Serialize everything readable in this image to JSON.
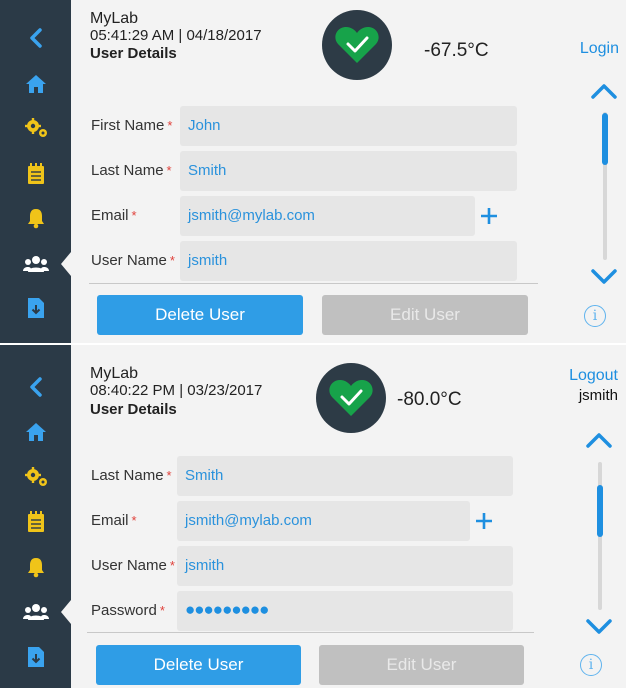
{
  "colors": {
    "sidebar_bg": "#2b3a47",
    "main_bg": "#f3f3f3",
    "accent": "#1e8fe0",
    "heart": "#17a34a",
    "required": "#e0403a",
    "disabled_button": "#c0c0c0"
  },
  "screens": [
    {
      "header": {
        "app_name": "MyLab",
        "datetime": "05:41:29 AM | 04/18/2017",
        "title": "User Details",
        "temperature": "-67.5°C",
        "auth_link": "Login",
        "username": ""
      },
      "sidebar": {
        "items": [
          {
            "name": "back",
            "icon": "chevron-left-icon"
          },
          {
            "name": "home",
            "icon": "home-icon"
          },
          {
            "name": "settings",
            "icon": "gears-icon"
          },
          {
            "name": "notepad",
            "icon": "notepad-icon"
          },
          {
            "name": "alarms",
            "icon": "bell-icon"
          },
          {
            "name": "users",
            "icon": "users-icon",
            "active": true
          },
          {
            "name": "export",
            "icon": "file-download-icon"
          }
        ]
      },
      "form": {
        "fields": [
          {
            "label": "First Name",
            "required_mark": "*",
            "value": "John"
          },
          {
            "label": "Last Name",
            "required_mark": "*",
            "value": "Smith"
          },
          {
            "label": "Email",
            "required_mark": "*",
            "value": "jsmith@mylab.com"
          },
          {
            "label": "User Name",
            "required_mark": "*",
            "value": "jsmith"
          }
        ]
      },
      "scroll": {
        "position": 0.0
      },
      "buttons": {
        "delete": "Delete User",
        "edit": "Edit User"
      },
      "info_glyph": "i"
    },
    {
      "header": {
        "app_name": "MyLab",
        "datetime": "08:40:22 PM | 03/23/2017",
        "title": "User Details",
        "temperature": "-80.0°C",
        "auth_link": "Logout",
        "username": "jsmith"
      },
      "sidebar": {
        "items": [
          {
            "name": "back",
            "icon": "chevron-left-icon"
          },
          {
            "name": "home",
            "icon": "home-icon"
          },
          {
            "name": "settings",
            "icon": "gears-icon"
          },
          {
            "name": "notepad",
            "icon": "notepad-icon"
          },
          {
            "name": "alarms",
            "icon": "bell-icon"
          },
          {
            "name": "users",
            "icon": "users-icon",
            "active": true
          },
          {
            "name": "export",
            "icon": "file-download-icon"
          }
        ]
      },
      "form": {
        "fields": [
          {
            "label": "Last Name",
            "required_mark": "*",
            "value": "Smith"
          },
          {
            "label": "Email",
            "required_mark": "*",
            "value": "jsmith@mylab.com"
          },
          {
            "label": "User Name",
            "required_mark": "*",
            "value": "jsmith"
          },
          {
            "label": "Password",
            "required_mark": "*",
            "value": "●●●●●●●●●"
          }
        ]
      },
      "scroll": {
        "position": 0.3
      },
      "buttons": {
        "delete": "Delete User",
        "edit": "Edit User"
      },
      "info_glyph": "i"
    }
  ]
}
